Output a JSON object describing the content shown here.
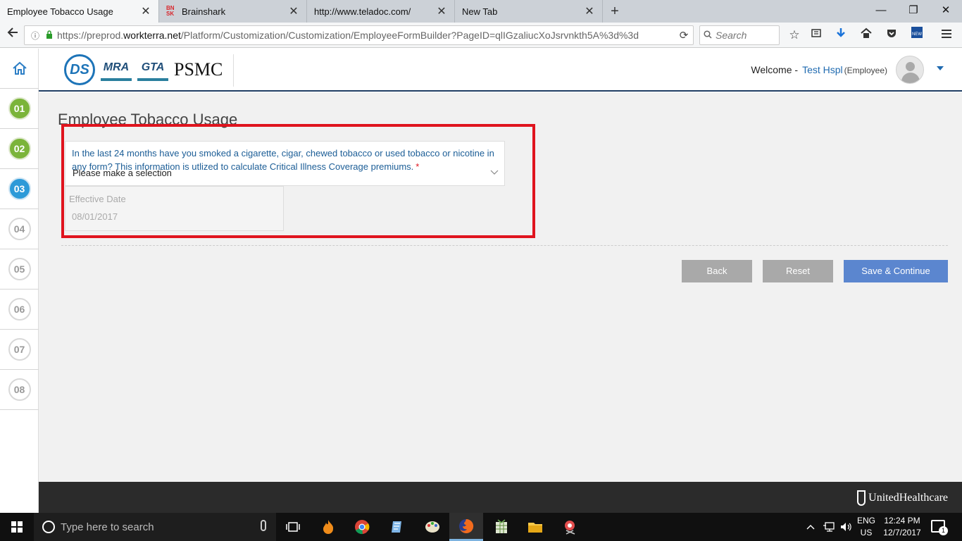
{
  "browser": {
    "tabs": [
      {
        "title": "Employee Tobacco Usage",
        "active": true
      },
      {
        "title": "Brainshark",
        "active": false,
        "favicon_text": "BN SK"
      },
      {
        "title": "http://www.teladoc.com/",
        "active": false
      },
      {
        "title": "New Tab",
        "active": false
      }
    ],
    "url": {
      "prefix": "https://preprod.",
      "domain": "workterra.net",
      "path": "/Platform/Customization/Customization/EmployeeFormBuilder?PageID=qlIGzaliucXoJsrvnkth5A%3d%3d"
    },
    "search_placeholder": "Search",
    "toolbar_icons": [
      "back-icon",
      "info-icon",
      "lock-icon",
      "reload-icon",
      "star-icon",
      "reader-icon",
      "download-icon",
      "home-icon",
      "pocket-icon",
      "extension-icon",
      "menu-icon"
    ]
  },
  "header": {
    "logo": {
      "ds": "DS",
      "mra": "MRA",
      "gta": "GTA",
      "psmc": "PSMC"
    },
    "welcome_label": "Welcome -",
    "user_name": "Test Hspl",
    "user_role": "(Employee)"
  },
  "steps": [
    {
      "label": "01",
      "state": "done"
    },
    {
      "label": "02",
      "state": "done"
    },
    {
      "label": "03",
      "state": "current"
    },
    {
      "label": "04",
      "state": "todo"
    },
    {
      "label": "05",
      "state": "todo"
    },
    {
      "label": "06",
      "state": "todo"
    },
    {
      "label": "07",
      "state": "todo"
    },
    {
      "label": "08",
      "state": "todo"
    }
  ],
  "form": {
    "title": "Employee Tobacco Usage",
    "question": "In the last 24 months have you smoked a cigarette, cigar, chewed tobacco or used tobacco or nicotine in any form? This information is utlized to calculate Critical Illness Coverage premiums.",
    "required_mark": "*",
    "select_value": "Please make a selection",
    "effective_date_label": "Effective Date",
    "effective_date_value": "08/01/2017"
  },
  "buttons": {
    "back": "Back",
    "reset": "Reset",
    "save": "Save & Continue"
  },
  "footer": {
    "brand": "UnitedHealthcare"
  },
  "taskbar": {
    "search_placeholder": "Type here to search",
    "lang_1": "ENG",
    "lang_2": "US",
    "time": "12:24 PM",
    "date": "12/7/2017",
    "notification_count": "1"
  },
  "colors": {
    "accent": "#2d9ad8",
    "done": "#7bb43a",
    "highlight": "#e0141e",
    "primary_button": "#5b86cf",
    "header_rule": "#1f3d63"
  }
}
